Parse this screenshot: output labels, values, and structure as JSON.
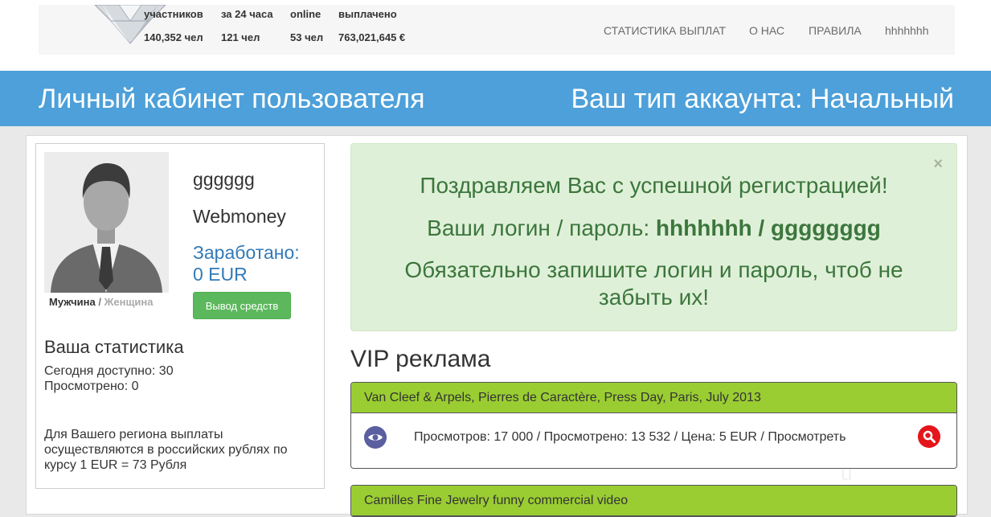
{
  "header": {
    "stats": [
      {
        "label": "участников",
        "value": "140,352 чел"
      },
      {
        "label": "за 24 часа",
        "value": "121 чел"
      },
      {
        "label": "online",
        "value": "53 чел"
      },
      {
        "label": "выплачено",
        "value": "763,021,645 €"
      }
    ],
    "nav": [
      "СТАТИСТИКА ВЫПЛАТ",
      "О НАС",
      "ПРАВИЛА",
      "hhhhhhh"
    ]
  },
  "banner": {
    "title": "Личный кабинет пользователя",
    "account_type": "Ваш тип аккаунта: Начальный"
  },
  "profile": {
    "username": "gggggg",
    "wallet": "Webmoney",
    "earned_label": "Заработано:",
    "earned_value": "0 EUR",
    "withdraw_label": "Вывод средств",
    "gender_male": "Мужчина",
    "gender_sep": "/",
    "gender_female": "Женщина",
    "stats_title": "Ваша статистика",
    "available_today": "Сегодня доступно: 30",
    "viewed": "Просмотрено: 0",
    "region_note": "Для Вашего региона выплаты осуществляются в российских рублях по курсу 1 EUR = 73 Рубля"
  },
  "alert": {
    "close": "×",
    "line1": "Поздравляем Вас с успешной регистрацией!",
    "line2_prefix": "Ваши логин / пароль: ",
    "login": "hhhhhhh",
    "line2_sep": " / ",
    "password": "gggggggg",
    "line3a": "Обязательно запишите логин и пароль, чтоб не",
    "line3b": "забыть их!"
  },
  "vip": {
    "title": "VIP реклама",
    "ads": [
      {
        "title": "Van Cleef & Arpels, Pierres de Caractère, Press Day, Paris, July 2013",
        "info": "Просмотров: 17 000 / Просмотрено: 13 532 / Цена: 5 EUR / Просмотреть"
      },
      {
        "title": "Camilles Fine Jewelry funny commercial video",
        "info": ""
      }
    ]
  },
  "watermark": "u",
  "colors": {
    "banner": "#4da0d9",
    "alert_bg": "#dff0d8",
    "alert_text": "#3c763d",
    "ad_head": "#9acd32",
    "button": "#5cb85c",
    "search": "#e5161b"
  },
  "icons": [
    "diamond-logo-icon",
    "user-avatar-icon",
    "eye-icon",
    "search-icon",
    "close-icon"
  ]
}
